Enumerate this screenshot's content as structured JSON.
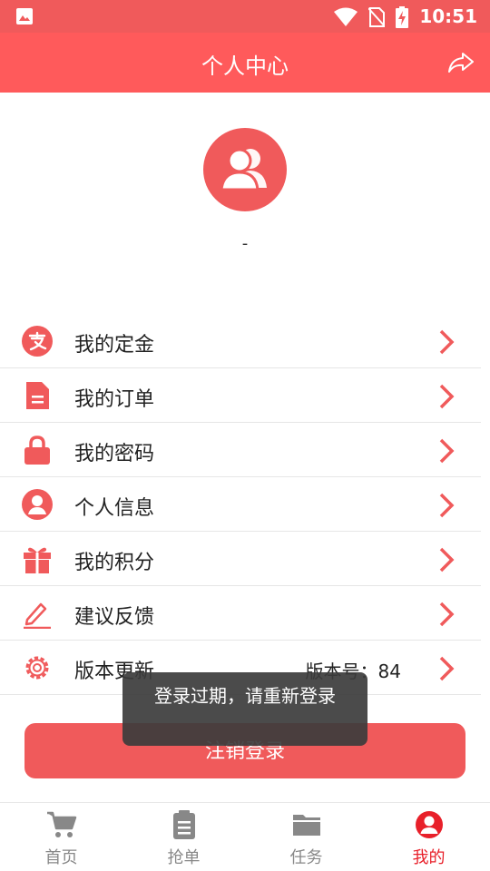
{
  "status_bar": {
    "time": "10:51"
  },
  "header": {
    "title": "个人中心"
  },
  "profile": {
    "name": "-"
  },
  "menu": [
    {
      "label": "我的定金",
      "icon": "alipay-icon"
    },
    {
      "label": "我的订单",
      "icon": "document-icon"
    },
    {
      "label": "我的密码",
      "icon": "lock-icon"
    },
    {
      "label": "个人信息",
      "icon": "user-circle-icon"
    },
    {
      "label": "我的积分",
      "icon": "gift-icon"
    },
    {
      "label": "建议反馈",
      "icon": "pencil-icon"
    },
    {
      "label": "版本更新",
      "icon": "gear-icon",
      "extra": "版本号：84"
    }
  ],
  "logout": {
    "label": "注销登录"
  },
  "toast": {
    "text": "登录过期，请重新登录"
  },
  "tabs": [
    {
      "label": "首页",
      "icon": "cart-icon",
      "active": false
    },
    {
      "label": "抢单",
      "icon": "clipboard-icon",
      "active": false
    },
    {
      "label": "任务",
      "icon": "folder-icon",
      "active": false
    },
    {
      "label": "我的",
      "icon": "user-circle-icon",
      "active": true
    }
  ],
  "colors": {
    "primary": "#f05a5b",
    "active_tab": "#e8202a",
    "inactive_tab": "#888888"
  }
}
